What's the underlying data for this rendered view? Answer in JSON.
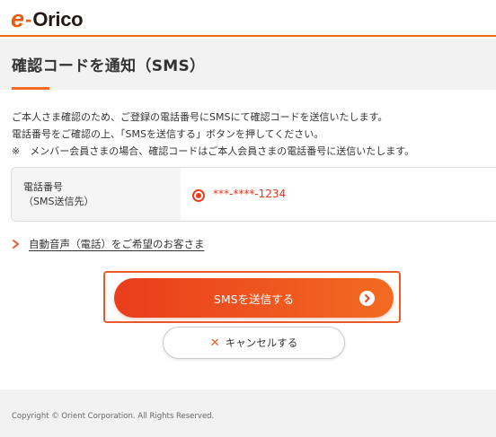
{
  "header": {
    "logo_e": "e",
    "logo_dash": "-",
    "logo_word": "Orico",
    "accent_color": "#f26b21"
  },
  "page": {
    "title": "確認コードを通知（SMS）"
  },
  "intro": {
    "line1": "ご本人さま確認のため、ご登録の電話番号にSMSにて確認コードを送信いたします。",
    "line2": "電話番号をご確認の上、「SMSを送信する」ボタンを押してください。",
    "line3": "※　メンバー会員さまの場合、確認コードはご本人会員さまの電話番号に送信いたします。"
  },
  "phone": {
    "label_line1": "電話番号",
    "label_line2": "（SMS送信先）",
    "number": "***-****-1234",
    "selected": true
  },
  "voice_link": {
    "label": "自動音声（電話）をご希望のお客さま"
  },
  "buttons": {
    "send_sms": "SMSを送信する",
    "cancel": "キャンセルする"
  },
  "icons": {
    "chevron": "chevron-right-icon",
    "send": "arrow-right-circle-icon",
    "cancel": "close-icon"
  },
  "footer": {
    "copyright": "Copyright © Orient Corporation. All Rights Reserved."
  }
}
